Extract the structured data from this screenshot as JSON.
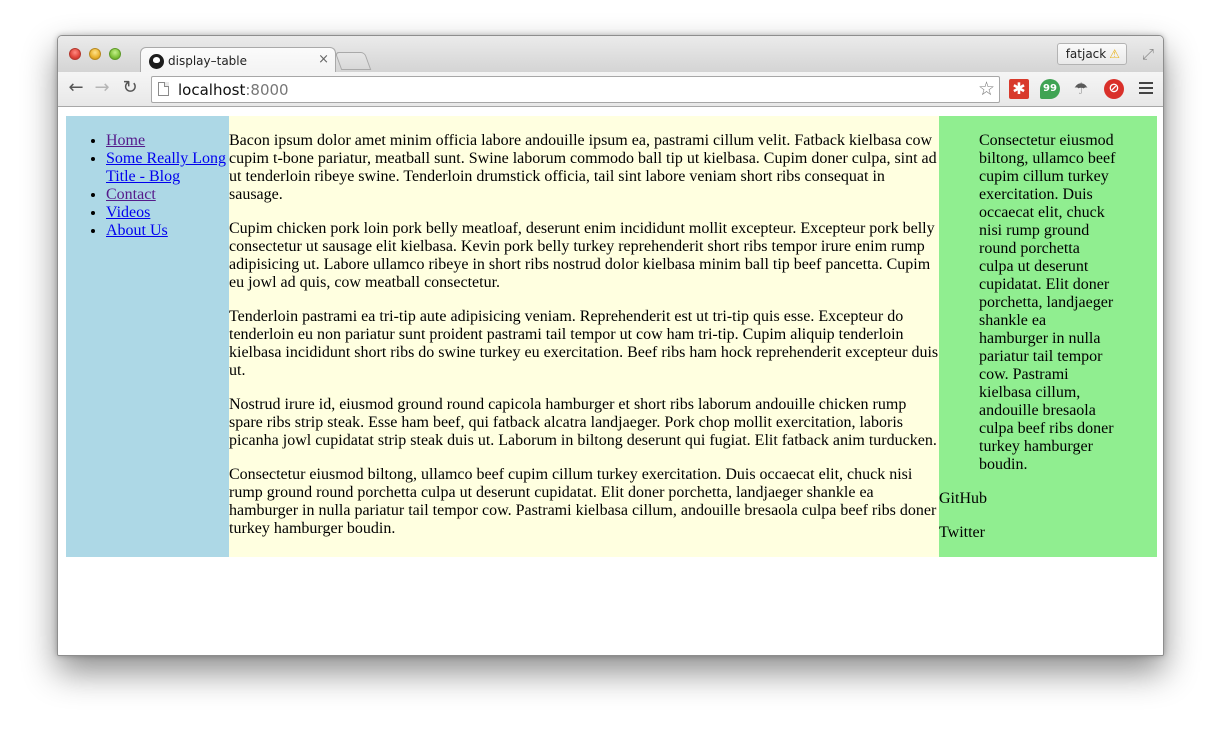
{
  "browser": {
    "tab_title": "display–table",
    "tab_close": "×",
    "profile_name": "fatjack",
    "warning_glyph": "⚠",
    "url_host": "localhost",
    "url_port": ":8000"
  },
  "nav": {
    "items": [
      {
        "label": "Home",
        "visited": true
      },
      {
        "label": "Some Really Long Title - Blog",
        "visited": false
      },
      {
        "label": "Contact",
        "visited": true
      },
      {
        "label": "Videos",
        "visited": false
      },
      {
        "label": "About Us",
        "visited": false
      }
    ]
  },
  "main": {
    "paragraphs": [
      "Bacon ipsum dolor amet minim officia labore andouille ipsum ea, pastrami cillum velit. Fatback kielbasa cow cupim t-bone pariatur, meatball sunt. Swine laborum commodo ball tip ut kielbasa. Cupim doner culpa, sint ad ut tenderloin ribeye swine. Tenderloin drumstick officia, tail sint labore veniam short ribs consequat in sausage.",
      "Cupim chicken pork loin pork belly meatloaf, deserunt enim incididunt mollit excepteur. Excepteur pork belly consectetur ut sausage elit kielbasa. Kevin pork belly turkey reprehenderit short ribs tempor irure enim rump adipisicing ut. Labore ullamco ribeye in short ribs nostrud dolor kielbasa minim ball tip beef pancetta. Cupim eu jowl ad quis, cow meatball consectetur.",
      "Tenderloin pastrami ea tri-tip aute adipisicing veniam. Reprehenderit est ut tri-tip quis esse. Excepteur do tenderloin eu non pariatur sunt proident pastrami tail tempor ut cow ham tri-tip. Cupim aliquip tenderloin kielbasa incididunt short ribs do swine turkey eu exercitation. Beef ribs ham hock reprehenderit excepteur duis ut.",
      "Nostrud irure id, eiusmod ground round capicola hamburger et short ribs laborum andouille chicken rump spare ribs strip steak. Esse ham beef, qui fatback alcatra landjaeger. Pork chop mollit exercitation, laboris picanha jowl cupidatat strip steak duis ut. Laborum in biltong deserunt qui fugiat. Elit fatback anim turducken.",
      "Consectetur eiusmod biltong, ullamco beef cupim cillum turkey exercitation. Duis occaecat elit, chuck nisi rump ground round porchetta culpa ut deserunt cupidatat. Elit doner porchetta, landjaeger shankle ea hamburger in nulla pariatur tail tempor cow. Pastrami kielbasa cillum, andouille bresaola culpa beef ribs doner turkey hamburger boudin."
    ]
  },
  "aside": {
    "quote": "Consectetur eiusmod biltong, ullamco beef cupim cillum turkey exercitation. Duis occaecat elit, chuck nisi rump ground round porchetta culpa ut deserunt cupidatat. Elit doner porchetta, landjaeger shankle ea hamburger in nulla pariatur tail tempor cow. Pastrami kielbasa cillum, andouille bresaola culpa beef ribs doner turkey hamburger boudin.",
    "links": [
      "GitHub",
      "Twitter"
    ]
  },
  "colors": {
    "nav_bg": "#add8e6",
    "main_bg": "#ffffe0",
    "aside_bg": "#90ee90"
  }
}
